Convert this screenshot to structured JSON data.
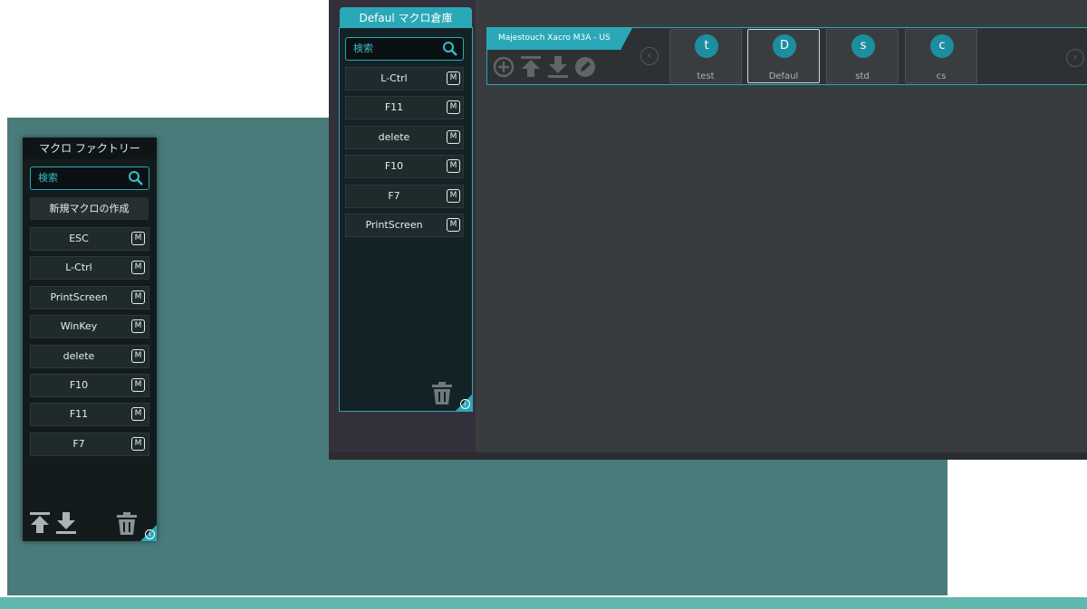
{
  "factory": {
    "title": "マクロ ファクトリー",
    "search_placeholder": "検索",
    "new_macro_label": "新規マクロの作成",
    "macros": [
      {
        "label": "ESC",
        "badge": "M"
      },
      {
        "label": "L-Ctrl",
        "badge": "M"
      },
      {
        "label": "PrintScreen",
        "badge": "M"
      },
      {
        "label": "WinKey",
        "badge": "M"
      },
      {
        "label": "delete",
        "badge": "M"
      },
      {
        "label": "F10",
        "badge": "M"
      },
      {
        "label": "F11",
        "badge": "M"
      },
      {
        "label": "F7",
        "badge": "M"
      }
    ],
    "info_glyph": "i"
  },
  "repository": {
    "title": "Defaul マクロ倉庫",
    "search_placeholder": "検索",
    "macros": [
      {
        "label": "L-Ctrl",
        "badge": "M"
      },
      {
        "label": "F11",
        "badge": "M"
      },
      {
        "label": "delete",
        "badge": "M"
      },
      {
        "label": "F10",
        "badge": "M"
      },
      {
        "label": "F7",
        "badge": "M"
      },
      {
        "label": "PrintScreen",
        "badge": "M"
      }
    ],
    "info_glyph": "i"
  },
  "keyboard": {
    "device_name": "Majestouch Xacro M3A - US",
    "nav_prev": "‹",
    "nav_next": "›",
    "profiles": [
      {
        "initial": "t",
        "name": "test",
        "active": false
      },
      {
        "initial": "D",
        "name": "Defaul",
        "active": true
      },
      {
        "initial": "s",
        "name": "std",
        "active": false
      },
      {
        "initial": "c",
        "name": "cs",
        "active": false
      }
    ]
  },
  "colors": {
    "accent": "#2aa8b8",
    "background_teal": "#4a7b7b",
    "panel_dark": "#141b1d",
    "app_bg": "#383c3e"
  }
}
